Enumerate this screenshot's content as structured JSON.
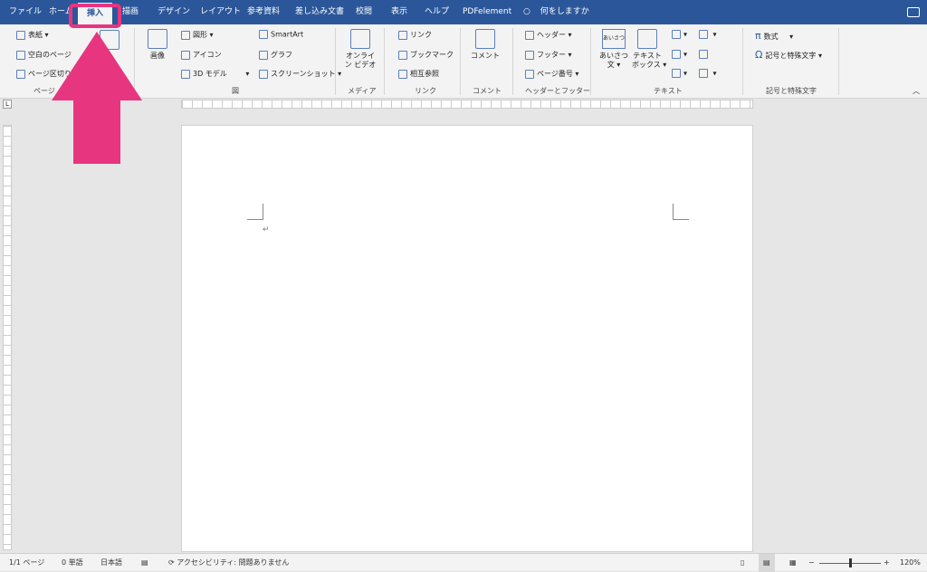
{
  "tabs": {
    "file": "ファイル",
    "home": "ホーム",
    "insert": "挿入",
    "draw": "描画",
    "design": "デザイン",
    "layout": "レイアウト",
    "references": "参考資料",
    "mailings": "差し込み文書",
    "review": "校閲",
    "view": "表示",
    "help": "ヘルプ",
    "pdfelement": "PDFelement",
    "tell_me": "何をしますか"
  },
  "ribbon": {
    "pages": {
      "cover": "表紙",
      "blank_page": "空白のページ",
      "page_break": "ページ区切り",
      "label": "ページ"
    },
    "illustrations": {
      "pictures": "画像",
      "shapes": "図形",
      "icons": "アイコン",
      "models_3d": "3D モデル",
      "smartart": "SmartArt",
      "chart": "グラフ",
      "screenshot": "スクリーンショット",
      "label": "図"
    },
    "media": {
      "online_video_line1": "オンライ",
      "online_video_line2": "ン ビデオ",
      "label": "メディア"
    },
    "links": {
      "link": "リンク",
      "bookmark": "ブックマーク",
      "cross_reference": "相互参照",
      "label": "リンク"
    },
    "comments": {
      "comment": "コメント",
      "label": "コメント"
    },
    "header_footer": {
      "header": "ヘッダー",
      "footer": "フッター",
      "page_number": "ページ番号",
      "label": "ヘッダーとフッター"
    },
    "text": {
      "greeting_icon": "あいさつ",
      "greeting_line1": "あいさつ",
      "greeting_line2": "文",
      "textbox_line1": "テキスト",
      "textbox_line2": "ボックス",
      "label": "テキスト"
    },
    "symbols": {
      "equation": "数式",
      "symbols": "記号と特殊文字",
      "label": "記号と特殊文字"
    }
  },
  "status": {
    "page": "1/1 ページ",
    "words": "0 単語",
    "language": "日本語",
    "accessibility": "アクセシビリティ: 問題ありません",
    "zoom": "120%"
  },
  "colors": {
    "tabbar": "#2b579a",
    "highlight": "#e8357f"
  }
}
